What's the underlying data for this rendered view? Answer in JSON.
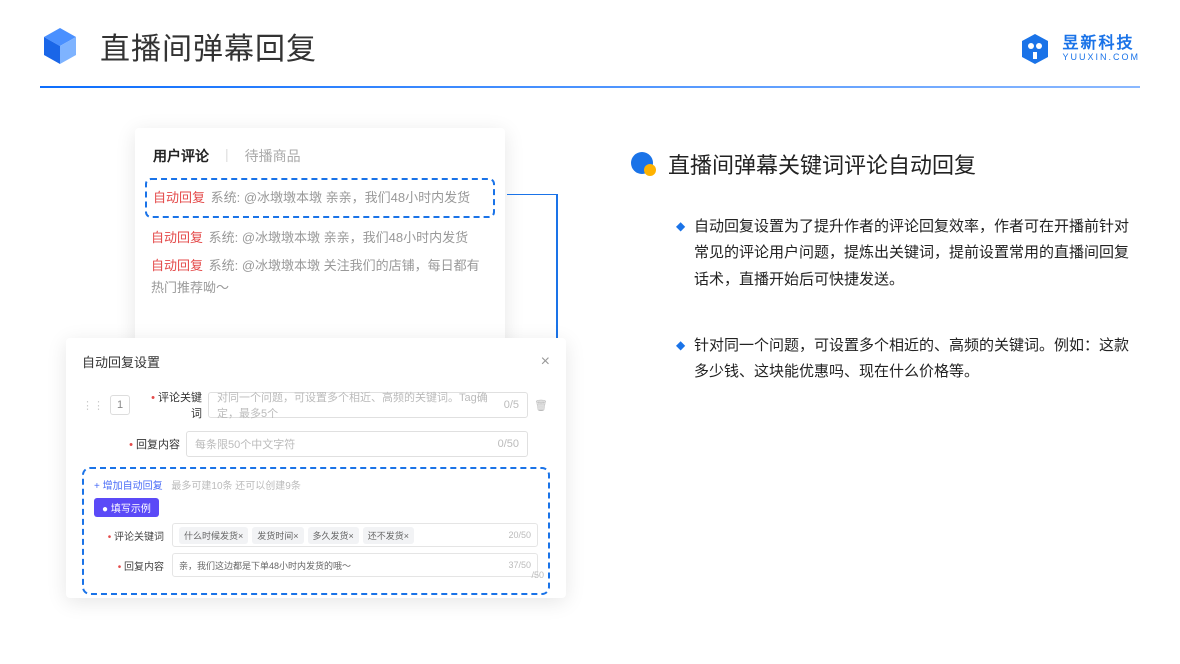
{
  "header": {
    "title": "直播间弹幕回复"
  },
  "brand": {
    "name": "昱新科技",
    "domain": "YUUXIN.COM"
  },
  "topcard": {
    "tab1": "用户评论",
    "tab2": "待播商品",
    "c1_badge": "自动回复",
    "c1_text": "系统: @冰墩墩本墩 亲亲，我们48小时内发货",
    "c2_badge": "自动回复",
    "c2_text": "系统: @冰墩墩本墩 亲亲，我们48小时内发货",
    "c3_badge": "自动回复",
    "c3_text": "系统: @冰墩墩本墩 关注我们的店铺，每日都有热门推荐呦～"
  },
  "settings": {
    "title": "自动回复设置",
    "idx": "1",
    "row1_label": "评论关键词",
    "row1_ph": "对同一个问题，可设置多个相近、高频的关键词。Tag确定，最多5个",
    "row1_count": "0/5",
    "row2_label": "回复内容",
    "row2_ph": "每条限50个中文字符",
    "row2_count": "0/50",
    "add_link": "+ 增加自动回复",
    "add_sub": "最多可建10条 还可以创建9条",
    "pill": "● 填写示例",
    "ex_row1_label": "评论关键词",
    "ex_tags": [
      "什么时候发货×",
      "发货时间×",
      "多久发货×",
      "还不发货×"
    ],
    "ex_row1_count": "20/50",
    "ex_row2_label": "回复内容",
    "ex_row2_text": "亲，我们这边都是下单48小时内发货的哦～",
    "ex_row2_count": "37/50",
    "tiny_count": "/50"
  },
  "right": {
    "heading": "直播间弹幕关键词评论自动回复",
    "b1": "自动回复设置为了提升作者的评论回复效率，作者可在开播前针对常见的评论用户问题，提炼出关键词，提前设置常用的直播间回复话术，直播开始后可快捷发送。",
    "b2": "针对同一个问题，可设置多个相近的、高频的关键词。例如：这款多少钱、这块能优惠吗、现在什么价格等。"
  }
}
